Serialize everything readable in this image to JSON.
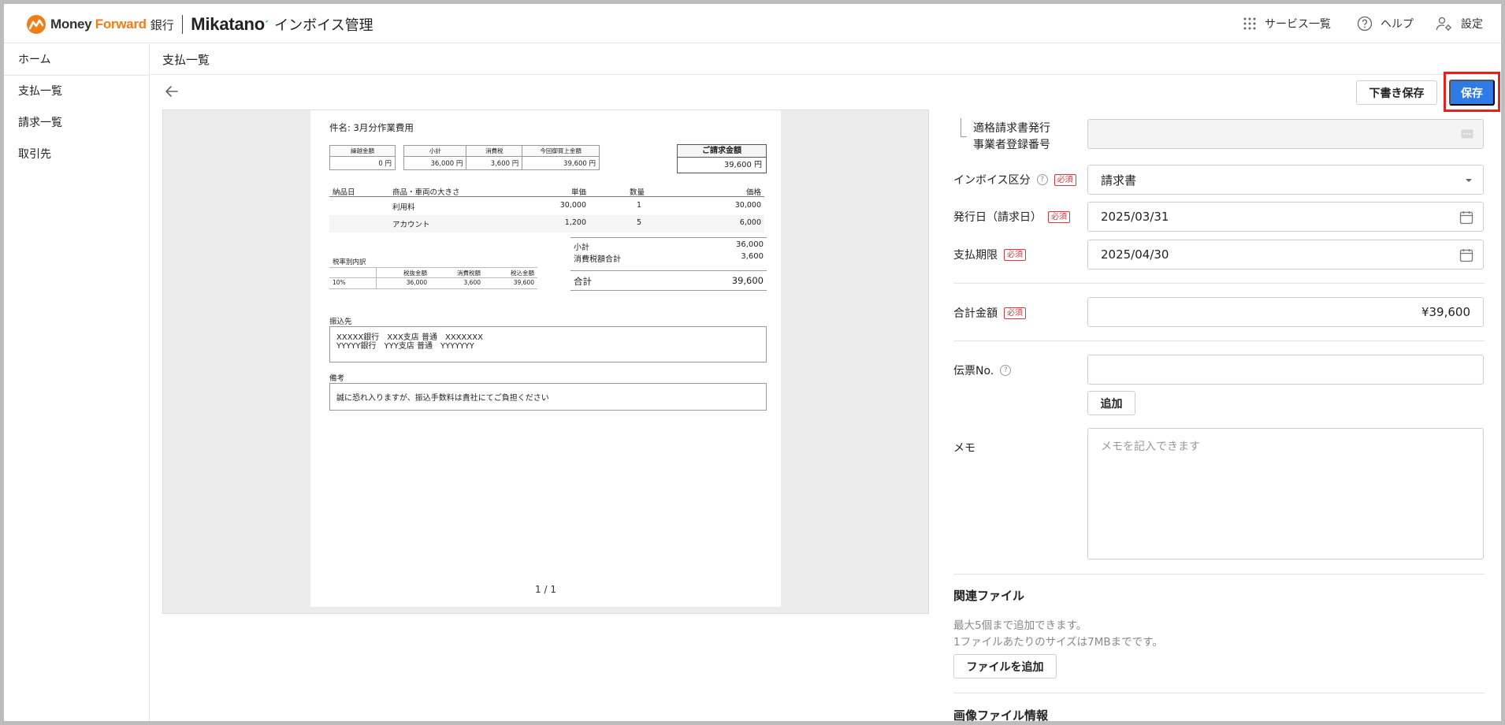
{
  "header": {
    "brand_money": "Money ",
    "brand_forward": "Forward",
    "brand_bank": "銀行",
    "mikatano": "Mikatano",
    "product": "インボイス管理",
    "nav": [
      {
        "label": "サービス一覧",
        "icon": "grid-icon"
      },
      {
        "label": "ヘルプ",
        "icon": "help-circle-icon"
      },
      {
        "label": "設定",
        "icon": "user-gear-icon"
      }
    ]
  },
  "sidebar": {
    "items": [
      {
        "label": "ホーム"
      },
      {
        "label": "支払一覧"
      },
      {
        "label": "請求一覧"
      },
      {
        "label": "取引先"
      }
    ]
  },
  "page": {
    "title": "支払一覧",
    "draft_save_label": "下書き保存",
    "save_label": "保存"
  },
  "document": {
    "subject": "件名: 3月分作業費用",
    "summary": {
      "carryover_header": "繰越金額",
      "carryover_value": "0 円",
      "headers": [
        "小計",
        "消費税",
        "今回御買上金額"
      ],
      "values": [
        "36,000 円",
        "3,600 円",
        "39,600 円"
      ],
      "total_header": "ご請求金額",
      "total_value": "39,600 円"
    },
    "items_headers": [
      "納品日",
      "商品・車両の大きさ",
      "単価",
      "数量",
      "価格"
    ],
    "items": [
      {
        "name": "利用料",
        "unit": "30,000",
        "qty": "1",
        "price": "30,000"
      },
      {
        "name": "アカウント",
        "unit": "1,200",
        "qty": "5",
        "price": "6,000"
      }
    ],
    "tax_breakdown": {
      "label": "税率別内訳",
      "headers": [
        "税抜金額",
        "消費税額",
        "税込金額"
      ],
      "rate": "10%",
      "values": [
        "36,000",
        "3,600",
        "39,600"
      ]
    },
    "totals": [
      {
        "label": "小計",
        "value": "36,000"
      },
      {
        "label": "消費税額合計",
        "value": "3,600"
      },
      {
        "label": "合計",
        "value": "39,600"
      }
    ],
    "bank_label": "振込先",
    "bank_lines": [
      "XXXXX銀行　XXX支店 普通　XXXXXXX",
      "YYYYY銀行　YYY支店 普通　YYYYYYY"
    ],
    "note_label": "備考",
    "note_text": "誠に恐れ入りますが、振込手数料は貴社にてご負担ください",
    "page_indicator": "1 / 1"
  },
  "form": {
    "registration_label_1": "適格請求書発行",
    "registration_label_2": "事業者登録番号",
    "required_badge": "必須",
    "invoice_type_label": "インボイス区分",
    "invoice_type_value": "請求書",
    "issue_date_label": "発行日（請求日）",
    "issue_date_value": "2025/03/31",
    "due_date_label": "支払期限",
    "due_date_value": "2025/04/30",
    "total_label": "合計金額",
    "total_value": "¥39,600",
    "slip_label": "伝票No.",
    "slip_value": "",
    "add_label": "追加",
    "memo_label": "メモ",
    "memo_placeholder": "メモを記入できます",
    "files_heading": "関連ファイル",
    "files_hint_1": "最大5個まで追加できます。",
    "files_hint_2": "1ファイルあたりのサイズは7MBまでです。",
    "add_file_label": "ファイルを追加",
    "image_info_heading": "画像ファイル情報"
  },
  "colors": {
    "primary": "#2f7be5",
    "required": "#d9363e",
    "highlight": "#e0231c",
    "brand_orange": "#ef7d1a"
  }
}
